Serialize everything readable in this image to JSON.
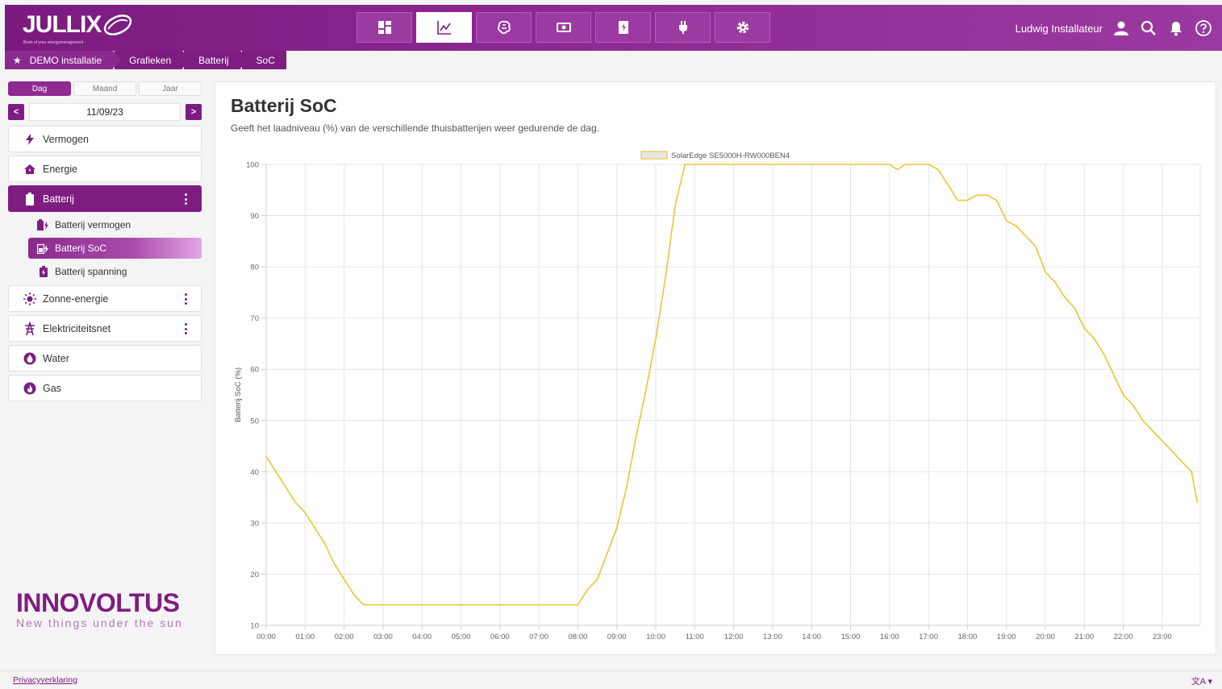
{
  "header": {
    "logo_text": "JULLIX",
    "logo_tagline": "Brain of your energymanagement",
    "nav": [
      {
        "icon": "dashboard-icon",
        "active": false
      },
      {
        "icon": "chart-line-icon",
        "active": true
      },
      {
        "icon": "brain-icon",
        "active": false
      },
      {
        "icon": "money-icon",
        "active": false
      },
      {
        "icon": "building-bolt-icon",
        "active": false
      },
      {
        "icon": "plug-icon",
        "active": false
      },
      {
        "icon": "gear-icon",
        "active": false
      }
    ],
    "user_name": "Ludwig Installateur"
  },
  "breadcrumb": [
    "DEMO installatie",
    "Grafieken",
    "Batterij",
    "SoC"
  ],
  "sidebar": {
    "periods": [
      "Dag",
      "Maand",
      "Jaar"
    ],
    "active_period": "Dag",
    "prev_label": "<",
    "next_label": ">",
    "date": "11/09/23",
    "items": [
      {
        "label": "Vermogen",
        "icon": "bolt-icon"
      },
      {
        "label": "Energie",
        "icon": "house-icon"
      },
      {
        "label": "Batterij",
        "icon": "battery-icon",
        "active": true
      },
      {
        "label": "Zonne-energie",
        "icon": "sun-icon"
      },
      {
        "label": "Elektriciteitsnet",
        "icon": "pylon-icon"
      },
      {
        "label": "Water",
        "icon": "water-icon"
      },
      {
        "label": "Gas",
        "icon": "flame-icon"
      }
    ],
    "sub_items": [
      {
        "label": "Batterij vermogen",
        "icon": "battery-power-icon"
      },
      {
        "label": "Batterij SoC",
        "icon": "battery-soc-icon",
        "active": true
      },
      {
        "label": "Batterij spanning",
        "icon": "battery-voltage-icon"
      }
    ],
    "brand_name": "INNOVOLTUS",
    "brand_slogan": "New things under the sun"
  },
  "main": {
    "title": "Batterij SoC",
    "description": "Geeft het laadniveau (%) van de verschillende thuisbatterijen weer gedurende de dag."
  },
  "chart_data": {
    "type": "line",
    "ylabel": "Batterij SoC (%)",
    "xlabel": "",
    "ylim": [
      10,
      100
    ],
    "yticks": [
      10,
      20,
      30,
      40,
      50,
      60,
      70,
      80,
      90,
      100
    ],
    "xticks": [
      "00:00",
      "01:00",
      "02:00",
      "03:00",
      "04:00",
      "05:00",
      "06:00",
      "07:00",
      "08:00",
      "09:00",
      "10:00",
      "11:00",
      "12:00",
      "13:00",
      "14:00",
      "15:00",
      "16:00",
      "17:00",
      "18:00",
      "19:00",
      "20:00",
      "21:00",
      "22:00",
      "23:00"
    ],
    "grid": true,
    "legend_position": "top",
    "series": [
      {
        "name": "SolarEdge  SE5000H-RW000BEN4",
        "color": "#f1c232",
        "x_hours": [
          0,
          0.25,
          0.5,
          0.75,
          1.0,
          1.25,
          1.5,
          1.75,
          2.0,
          2.25,
          2.5,
          3.0,
          4.0,
          5.0,
          6.0,
          7.0,
          8.0,
          8.25,
          8.5,
          8.75,
          9.0,
          9.25,
          9.5,
          9.75,
          10.0,
          10.25,
          10.5,
          10.75,
          11.0,
          12.0,
          13.0,
          14.0,
          15.0,
          16.0,
          16.2,
          16.4,
          17.0,
          17.25,
          17.5,
          17.75,
          18.0,
          18.25,
          18.5,
          18.75,
          19.0,
          19.25,
          19.5,
          19.75,
          20.0,
          20.25,
          20.5,
          20.75,
          21.0,
          21.25,
          21.5,
          21.75,
          22.0,
          22.25,
          22.5,
          22.75,
          23.0,
          23.25,
          23.5,
          23.75,
          23.9
        ],
        "values": [
          43,
          40,
          37,
          34,
          32,
          29,
          26,
          22,
          19,
          16,
          14,
          14,
          14,
          14,
          14,
          14,
          14,
          17,
          19,
          24,
          29,
          37,
          47,
          56,
          66,
          78,
          92,
          100,
          100,
          100,
          100,
          100,
          100,
          100,
          99,
          100,
          100,
          99,
          96,
          93,
          93,
          94,
          94,
          93,
          89,
          88,
          86,
          84,
          79,
          77,
          74,
          72,
          68,
          66,
          63,
          59,
          55,
          53,
          50,
          48,
          46,
          44,
          42,
          40,
          34
        ]
      }
    ]
  },
  "footer": {
    "privacy": "Privacyverklaring",
    "language": "文A ▾"
  },
  "colors": {
    "brand": "#7d1d82",
    "line": "#f1c232"
  }
}
